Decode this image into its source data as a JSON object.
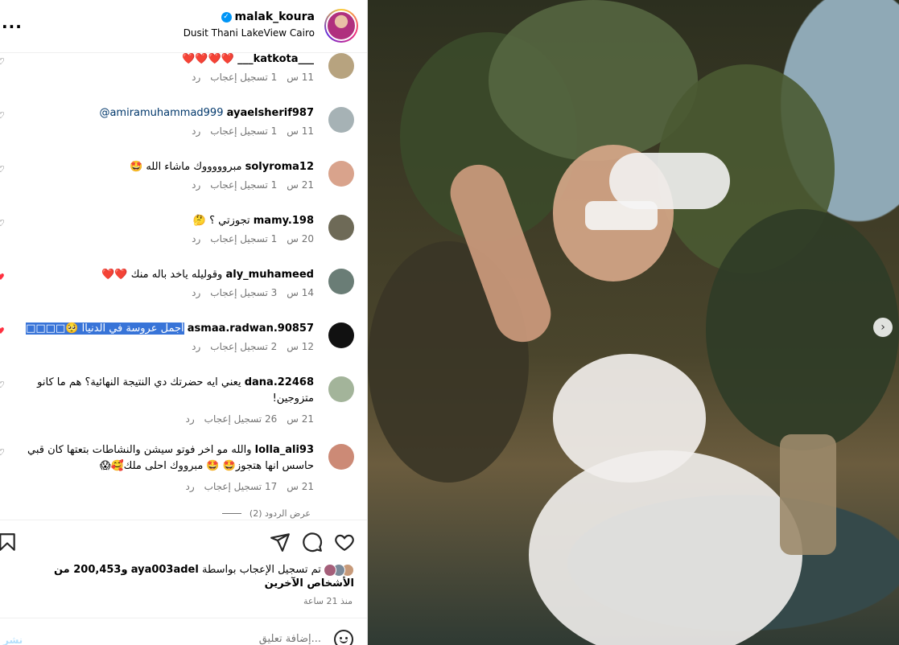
{
  "header": {
    "username": "malak_koura",
    "location": "Dusit Thani LakeView Cairo",
    "more": "..."
  },
  "comments": [
    {
      "user": "___katkota___",
      "text": "",
      "emoji": "❤️❤️❤️❤️",
      "time": "11 س",
      "likes": "1 تسجيل إعجاب",
      "reply": "رد",
      "liked": false
    },
    {
      "user": "ayaelsherif987",
      "mention": "@amiramuhammad999",
      "text": "",
      "emoji": "",
      "time": "11 س",
      "likes": "1 تسجيل إعجاب",
      "reply": "رد",
      "liked": false
    },
    {
      "user": "solyroma12",
      "text": "مبروووووك ماشاء الله",
      "emoji": "🤩",
      "time": "21 س",
      "likes": "1 تسجيل إعجاب",
      "reply": "رد",
      "liked": false
    },
    {
      "user": "mamy.198",
      "text": "تجوزتي ؟",
      "emoji": "🤔",
      "time": "20 س",
      "likes": "1 تسجيل إعجاب",
      "reply": "رد",
      "liked": false
    },
    {
      "user": "aly_muhameed",
      "text": "وقوليله ياخد باله منك",
      "emoji": "❤️❤️",
      "time": "14 س",
      "likes": "3 تسجيل إعجاب",
      "reply": "رد",
      "liked": true
    },
    {
      "user": "asmaa.radwan.90857",
      "text": "أجمل عروسة في الدنياا",
      "emoji": "🥺□□□□",
      "time": "12 س",
      "likes": "2 تسجيل إعجاب",
      "reply": "رد",
      "liked": true,
      "selected": true
    },
    {
      "user": "dana.22468",
      "text": "يعني ايه حضرتك دي النتيجة النهائية؟ هم ما كانو متزوجين!",
      "emoji": "",
      "time": "21 س",
      "likes": "26 تسجيل إعجاب",
      "reply": "رد",
      "liked": false
    },
    {
      "user": "lolla_ali93",
      "text": "والله مو اخر فوتو سيشن والنشاطات بتعتها كان قبي حاسس انها هتجوز🤩 🤩 مبرووك احلى ملك🥰😱",
      "emoji": "",
      "time": "21 س",
      "likes": "17 تسجيل إعجاب",
      "reply": "رد",
      "liked": false
    }
  ],
  "view_replies": "عرض الردود (2)",
  "likes_summary": {
    "prefix": "تم تسجيل الإعجاب بواسطة",
    "user": "aya003adel",
    "rest": "و200,453 من الأشخاص الآخرين"
  },
  "time_ago": "منذ 21 ساعة",
  "add_comment": {
    "placeholder": "إضافة تعليق...",
    "post": "نشر"
  },
  "icons": {
    "like": "heart-icon",
    "comment": "comment-icon",
    "share": "share-icon",
    "save": "bookmark-icon",
    "emoji": "emoji-icon",
    "next": "chevron-right-icon"
  }
}
